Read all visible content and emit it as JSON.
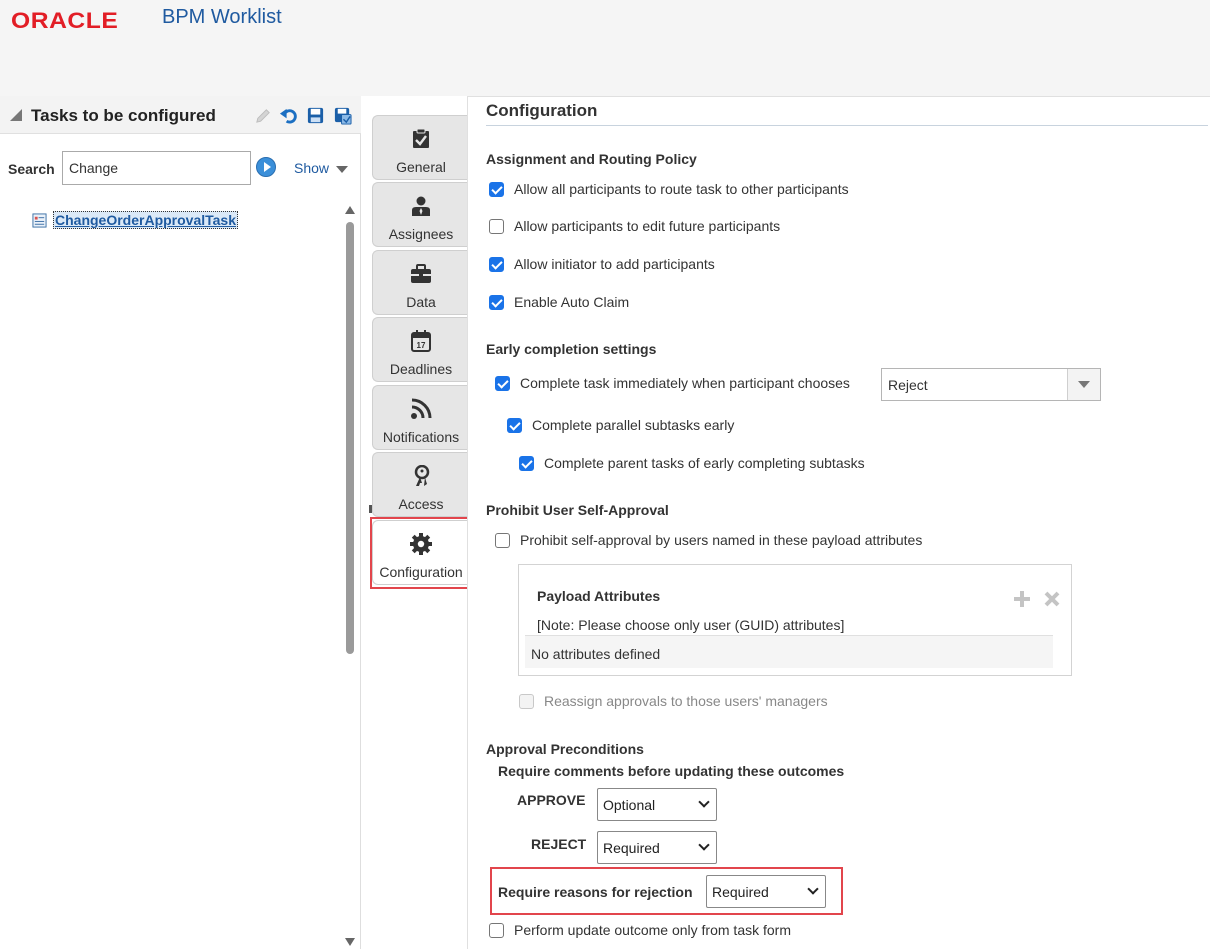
{
  "app": {
    "logo": "ORACLE",
    "title": "BPM Worklist"
  },
  "left_panel": {
    "title": "Tasks to be configured",
    "search_label": "Search",
    "search_value": "Change",
    "show_label": "Show",
    "tree_items": [
      {
        "label": "ChangeOrderApprovalTask"
      }
    ]
  },
  "tabs": [
    {
      "label": "General",
      "icon": "checklist-icon"
    },
    {
      "label": "Assignees",
      "icon": "person-icon"
    },
    {
      "label": "Data",
      "icon": "briefcase-icon"
    },
    {
      "label": "Deadlines",
      "icon": "calendar-icon"
    },
    {
      "label": "Notifications",
      "icon": "rss-icon"
    },
    {
      "label": "Access",
      "icon": "keys-icon"
    },
    {
      "label": "Configuration",
      "icon": "gear-icon"
    }
  ],
  "active_tab": "Configuration",
  "calendar_day": "17",
  "content": {
    "title": "Configuration",
    "assignment": {
      "heading": "Assignment and Routing Policy",
      "options": [
        {
          "label": "Allow all participants to route task to other participants",
          "checked": true
        },
        {
          "label": "Allow participants to edit future participants",
          "checked": false
        },
        {
          "label": "Allow initiator to add participants",
          "checked": true
        },
        {
          "label": "Enable Auto Claim",
          "checked": true
        }
      ]
    },
    "early_completion": {
      "heading": "Early completion settings",
      "complete_immediately": {
        "label": "Complete task immediately when participant chooses",
        "checked": true
      },
      "outcome_value": "Reject",
      "parallel_subtasks": {
        "label": "Complete parallel subtasks early",
        "checked": true
      },
      "parent_tasks": {
        "label": "Complete parent tasks of early completing subtasks",
        "checked": true
      }
    },
    "self_approval": {
      "heading": "Prohibit User Self-Approval",
      "prohibit": {
        "label": "Prohibit self-approval by users named in these payload attributes",
        "checked": false
      },
      "payload_title": "Payload Attributes",
      "payload_note": "[Note: Please choose only user (GUID) attributes]",
      "payload_empty": "No attributes defined",
      "reassign": {
        "label": "Reassign approvals to those users' managers",
        "checked": false,
        "disabled": true
      }
    },
    "preconditions": {
      "heading": "Approval Preconditions",
      "subheading": "Require comments before updating these outcomes",
      "approve_label": "APPROVE",
      "approve_value": "Optional",
      "reject_label": "REJECT",
      "reject_value": "Required",
      "reasons_label": "Require reasons for rejection",
      "reasons_value": "Required",
      "task_form_only": {
        "label": "Perform update outcome only from task form",
        "checked": false
      }
    }
  },
  "colors": {
    "brand_red": "#e21e26",
    "link_blue": "#1f5aa0",
    "checkbox_blue": "#1a73e8",
    "highlight_red": "#e2454c"
  }
}
